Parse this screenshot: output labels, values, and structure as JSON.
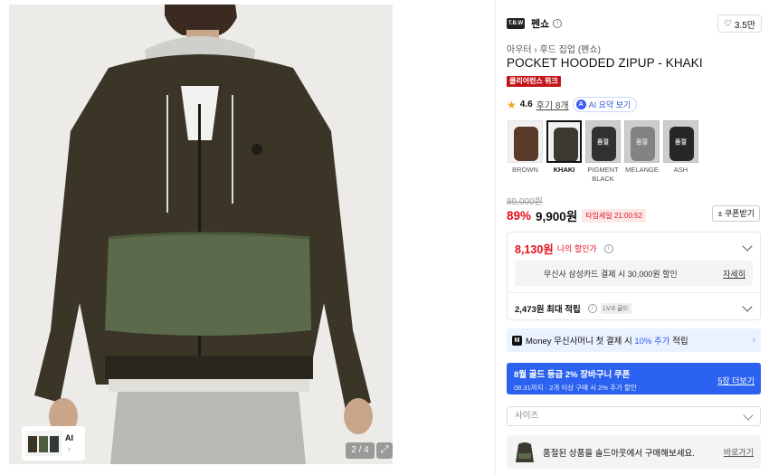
{
  "gallery": {
    "counter": "2 / 4",
    "thumb_ai_label": "AI",
    "thumb_chevron": "›"
  },
  "brand": {
    "logo_text": "T.B.W",
    "name": "펜쇼",
    "info_icon": "i",
    "likes": "3.5만"
  },
  "product": {
    "breadcrumb": "아우터 › 후드 집업 (펜쇼)",
    "title": "POCKET HOODED ZIPUP - KHAKI",
    "badge": "클리어런스 위크",
    "rating": "4.6",
    "reviews": "후기 8개",
    "ai_summary": "AI 요약 보기",
    "ai_icon": "A"
  },
  "colors": [
    {
      "name": "BROWN",
      "selected": false,
      "soldout": false,
      "fill": "#5a3b2a"
    },
    {
      "name": "KHAKI",
      "selected": true,
      "soldout": false,
      "fill": "#3c3a30"
    },
    {
      "name": "PIGMENT BLACK",
      "selected": false,
      "soldout": true,
      "fill": "#3a3a3a"
    },
    {
      "name": "MELANGE",
      "selected": false,
      "soldout": true,
      "fill": "#9a9a9a"
    },
    {
      "name": "ASH",
      "selected": false,
      "soldout": true,
      "fill": "#2e2e2e"
    }
  ],
  "soldout_label": "품절",
  "price": {
    "original": "89,000원",
    "discount": "89%",
    "current": "9,900원",
    "timesale": "타임세일 21:00:52",
    "coupon_button": "± 쿠폰받기",
    "discount_color": "#e3101c"
  },
  "benefits": {
    "my_price": "8,130원",
    "my_price_label": "나의 할인가",
    "card_text": "무신사 삼성카드 결제 시 30,000원 할인",
    "card_detail": "자세히",
    "points": "2,473원 최대 적립",
    "level": "LV.6 골드"
  },
  "money": {
    "logo": "M",
    "prefix": "Money 무신사머니 첫 결제 시 ",
    "highlight": "10% 추가",
    "suffix": " 적립",
    "chevron": "›"
  },
  "coupon": {
    "title": "8월 골드 등급 2% 장바구니 쿠폰",
    "sub": "08.31까지 · 2개 이상 구매 시 2% 추가 할인",
    "more": "5장 더보기",
    "color": "#2c62f0"
  },
  "size": {
    "placeholder": "사이즈"
  },
  "soldout_notice": {
    "text": "품절된 상품을 솔드아웃에서 구매해보세요.",
    "link": "바로가기"
  }
}
